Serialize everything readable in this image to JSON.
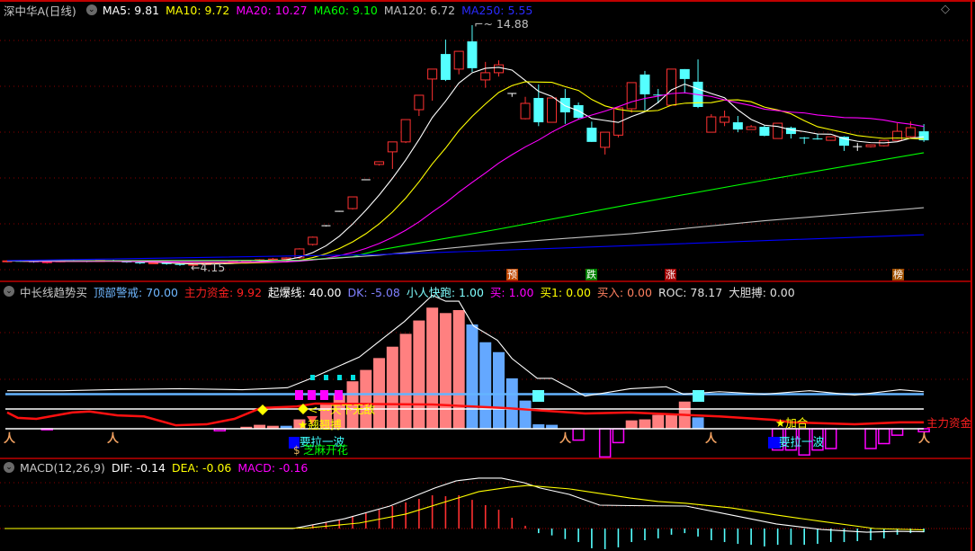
{
  "header": {
    "title": "深中华A(日线)",
    "ma5": "MA5: 9.81",
    "ma10": "MA10: 9.72",
    "ma20": "MA20: 10.27",
    "ma60": "MA60: 9.10",
    "ma120": "MA120: 6.72",
    "ma250": "MA250: 5.55"
  },
  "main_chart": {
    "high_label": "14.88",
    "low_label": "4.15",
    "badges": [
      "预",
      "跌",
      "涨",
      "榜"
    ],
    "candles": [
      [
        4.4,
        4.45,
        4.35,
        4.42
      ],
      [
        4.42,
        4.46,
        4.38,
        4.4
      ],
      [
        4.4,
        4.44,
        4.34,
        4.36
      ],
      [
        4.36,
        4.4,
        4.3,
        4.38
      ],
      [
        4.38,
        4.45,
        4.36,
        4.43
      ],
      [
        4.43,
        4.48,
        4.4,
        4.41
      ],
      [
        4.41,
        4.44,
        4.36,
        4.39
      ],
      [
        4.39,
        4.45,
        4.37,
        4.44
      ],
      [
        4.44,
        4.47,
        4.38,
        4.4
      ],
      [
        4.4,
        4.42,
        4.33,
        4.35
      ],
      [
        4.35,
        4.38,
        4.28,
        4.31
      ],
      [
        4.31,
        4.36,
        4.27,
        4.33
      ],
      [
        4.33,
        4.35,
        4.25,
        4.28
      ],
      [
        4.28,
        4.31,
        4.2,
        4.24
      ],
      [
        4.24,
        4.3,
        4.15,
        4.27
      ],
      [
        4.27,
        4.33,
        4.24,
        4.3
      ],
      [
        4.3,
        4.36,
        4.28,
        4.34
      ],
      [
        4.34,
        4.4,
        4.32,
        4.38
      ],
      [
        4.38,
        4.45,
        4.36,
        4.43
      ],
      [
        4.43,
        4.5,
        4.4,
        4.47
      ],
      [
        4.47,
        4.55,
        4.44,
        4.5
      ],
      [
        4.5,
        4.58,
        4.47,
        4.55
      ],
      [
        4.55,
        4.98,
        4.5,
        4.95
      ],
      [
        5.15,
        5.5,
        5.1,
        5.47
      ],
      [
        5.98,
        6.0,
        5.95,
        5.98
      ],
      [
        6.62,
        6.64,
        6.6,
        6.62
      ],
      [
        6.74,
        7.26,
        6.7,
        7.26
      ],
      [
        8.02,
        8.04,
        8.0,
        8.02
      ],
      [
        8.7,
        8.82,
        8.65,
        8.82
      ],
      [
        9.26,
        9.7,
        8.5,
        9.7
      ],
      [
        9.7,
        10.69,
        9.65,
        10.69
      ],
      [
        11.13,
        11.77,
        10.85,
        11.77
      ],
      [
        12.49,
        12.93,
        11.53,
        12.93
      ],
      [
        13.6,
        14.24,
        12.4,
        12.45
      ],
      [
        12.93,
        13.72,
        12.7,
        13.72
      ],
      [
        14.16,
        14.88,
        12.8,
        12.97
      ],
      [
        12.45,
        13.25,
        12.1,
        12.77
      ],
      [
        12.77,
        13.32,
        12.6,
        13.12
      ],
      [
        11.85,
        11.85,
        11.7,
        11.85
      ],
      [
        10.73,
        11.7,
        10.7,
        11.41
      ],
      [
        11.65,
        12.25,
        10.4,
        10.57
      ],
      [
        10.57,
        11.65,
        10.57,
        11.65
      ],
      [
        11.65,
        12.05,
        10.5,
        11.01
      ],
      [
        11.33,
        11.45,
        10.7,
        10.77
      ],
      [
        10.33,
        10.6,
        9.7,
        9.7
      ],
      [
        9.46,
        10.13,
        9.14,
        10.13
      ],
      [
        10.0,
        11.21,
        9.9,
        11.21
      ],
      [
        11.17,
        12.33,
        11.0,
        12.33
      ],
      [
        12.69,
        12.85,
        11.09,
        11.81
      ],
      [
        11.8,
        12.05,
        11.41,
        11.77
      ],
      [
        11.33,
        12.93,
        11.3,
        12.93
      ],
      [
        12.93,
        12.93,
        11.85,
        12.49
      ],
      [
        12.37,
        13.36,
        11.2,
        11.25
      ],
      [
        10.13,
        10.93,
        10.13,
        10.81
      ],
      [
        10.57,
        11.09,
        10.4,
        10.81
      ],
      [
        10.57,
        10.85,
        10.13,
        10.25
      ],
      [
        10.25,
        10.45,
        10.25,
        10.37
      ],
      [
        10.37,
        10.45,
        9.95,
        9.97
      ],
      [
        9.85,
        10.53,
        9.85,
        10.53
      ],
      [
        10.33,
        10.38,
        9.85,
        10.05
      ],
      [
        9.89,
        9.92,
        9.61,
        9.87
      ],
      [
        9.85,
        10.05,
        9.8,
        9.83
      ],
      [
        9.77,
        9.93,
        9.75,
        9.93
      ],
      [
        9.93,
        9.95,
        9.3,
        9.53
      ],
      [
        9.49,
        9.65,
        9.3,
        9.49
      ],
      [
        9.49,
        9.57,
        9.45,
        9.57
      ],
      [
        9.53,
        9.77,
        9.5,
        9.77
      ],
      [
        9.77,
        10.53,
        9.75,
        10.17
      ],
      [
        9.93,
        10.61,
        9.9,
        10.33
      ],
      [
        10.17,
        10.49,
        9.7,
        9.77
      ]
    ],
    "ma60": [
      [
        0,
        4.42
      ],
      [
        22,
        4.45
      ],
      [
        26,
        4.6
      ],
      [
        28,
        4.9
      ],
      [
        37,
        5.83
      ],
      [
        47,
        6.94
      ],
      [
        57,
        8.0
      ],
      [
        69,
        9.22
      ]
    ],
    "ma120": [
      [
        0,
        4.42
      ],
      [
        22,
        4.43
      ],
      [
        28,
        4.67
      ],
      [
        37,
        5.2
      ],
      [
        47,
        5.63
      ],
      [
        57,
        6.2
      ],
      [
        69,
        6.78
      ]
    ],
    "ma250": [
      [
        0,
        4.43
      ],
      [
        28,
        4.7
      ],
      [
        47,
        5.1
      ],
      [
        69,
        5.58
      ]
    ],
    "colors": {
      "ma5": "#ffffff",
      "ma10": "#ffff00",
      "ma20": "#ff00ff",
      "ma60": "#00ff00",
      "ma120": "#c0c0c0",
      "ma250": "#0000ff",
      "up": "#ff3232",
      "down": "#54ffff"
    }
  },
  "indicator": {
    "name": "中长线趋势买",
    "values": [
      {
        "label": "顶部警戒: 70.00",
        "color": "#6fb7ff"
      },
      {
        "label": "主力资金: 9.92",
        "color": "#ff2020"
      },
      {
        "label": "起爆线: 40.00",
        "color": "#ffffff"
      },
      {
        "label": "DK: -5.08",
        "color": "#8080ff"
      },
      {
        "label": "小人快跑: 1.00",
        "color": "#80ffff"
      },
      {
        "label": "买: 1.00",
        "color": "#ff00ff"
      },
      {
        "label": "买1: 0.00",
        "color": "#ffff00"
      },
      {
        "label": "买入: 0.00",
        "color": "#ff8060"
      },
      {
        "label": "ROC: 78.17",
        "color": "#e0e0e0"
      },
      {
        "label": "大胆搏: 0.00",
        "color": "#e0e0e0"
      }
    ],
    "top_warning_level": 70,
    "ignite_level": 40,
    "bars_up": [
      [
        18,
        4
      ],
      [
        19,
        8
      ],
      [
        20,
        6
      ],
      [
        22,
        19
      ],
      [
        24,
        51
      ],
      [
        25,
        70
      ],
      [
        26,
        96
      ],
      [
        27,
        119
      ],
      [
        28,
        143
      ],
      [
        29,
        166
      ],
      [
        30,
        192
      ],
      [
        31,
        219
      ],
      [
        32,
        245
      ],
      [
        33,
        234
      ],
      [
        34,
        240
      ],
      [
        47,
        17
      ],
      [
        48,
        19
      ],
      [
        49,
        28
      ],
      [
        50,
        30
      ],
      [
        51,
        55
      ]
    ],
    "bars_down": [
      [
        21,
        6
      ],
      [
        35,
        211
      ],
      [
        36,
        175
      ],
      [
        37,
        155
      ],
      [
        38,
        102
      ],
      [
        39,
        57
      ],
      [
        40,
        9
      ],
      [
        41,
        8
      ],
      [
        52,
        23
      ]
    ],
    "bars_neg": [
      [
        3,
        -2
      ],
      [
        16,
        -4
      ],
      [
        43,
        -23
      ],
      [
        45,
        -57
      ],
      [
        46,
        -28
      ],
      [
        58,
        -43
      ],
      [
        59,
        -43
      ],
      [
        60,
        -53
      ],
      [
        61,
        -43
      ],
      [
        62,
        -40
      ],
      [
        65,
        -40
      ],
      [
        66,
        -30
      ],
      [
        67,
        -13
      ],
      [
        69,
        -6
      ]
    ],
    "roc_line": [
      [
        0,
        77
      ],
      [
        4.2,
        77
      ],
      [
        7.6,
        79
      ],
      [
        13,
        81
      ],
      [
        17.7,
        79
      ],
      [
        21.1,
        83
      ],
      [
        22.7,
        100
      ],
      [
        26.5,
        145
      ],
      [
        29.9,
        217
      ],
      [
        32,
        270
      ],
      [
        33,
        258
      ],
      [
        34,
        258
      ],
      [
        35.1,
        208
      ],
      [
        36.9,
        179
      ],
      [
        38,
        142
      ],
      [
        39.9,
        102
      ],
      [
        41,
        102
      ],
      [
        43.5,
        66
      ],
      [
        46.9,
        81
      ],
      [
        49.6,
        85
      ],
      [
        50.9,
        70
      ],
      [
        53.6,
        75
      ],
      [
        57,
        70
      ],
      [
        60.4,
        77
      ],
      [
        63.8,
        68
      ],
      [
        67.2,
        79
      ],
      [
        69,
        75
      ]
    ],
    "main_fund_line": [
      [
        0,
        33
      ],
      [
        0.8,
        22
      ],
      [
        2.2,
        20
      ],
      [
        4.9,
        33
      ],
      [
        6.2,
        35
      ],
      [
        8.3,
        27
      ],
      [
        10.3,
        25
      ],
      [
        12.7,
        7
      ],
      [
        15,
        9
      ],
      [
        17.1,
        20
      ],
      [
        19.1,
        42
      ],
      [
        21.8,
        45
      ],
      [
        23.2,
        51
      ],
      [
        32,
        49
      ],
      [
        37.4,
        42
      ],
      [
        43.5,
        31
      ],
      [
        46.9,
        33
      ],
      [
        53.6,
        25
      ],
      [
        57.7,
        18
      ],
      [
        59,
        13
      ],
      [
        63.8,
        9
      ],
      [
        67.2,
        13
      ],
      [
        69,
        13
      ]
    ],
    "signals": {
      "invincible": "<---天下无敌",
      "bold_bet": "★翘翘搏",
      "pull_wave_1": "要拉一波",
      "sesame": "芝麻开花",
      "add_position": "★加合",
      "pull_wave_2": "要拉一波",
      "main_fund_label": "主力资金",
      "runner": "人"
    }
  },
  "macd": {
    "label": "MACD(12,26,9)",
    "dif": "DIF: -0.14",
    "dea": "DEA: -0.06",
    "macd": "MACD: -0.16",
    "bars": [
      [
        23,
        0.16
      ],
      [
        24,
        0.27
      ],
      [
        25,
        0.39
      ],
      [
        26,
        0.55
      ],
      [
        27,
        0.67
      ],
      [
        28,
        0.82
      ],
      [
        29,
        0.98
      ],
      [
        30,
        1.14
      ],
      [
        31,
        1.29
      ],
      [
        32,
        1.45
      ],
      [
        33,
        1.41
      ],
      [
        34,
        1.45
      ],
      [
        35,
        1.25
      ],
      [
        36,
        1.02
      ],
      [
        37,
        0.82
      ],
      [
        38,
        0.47
      ],
      [
        39,
        0.12
      ],
      [
        40,
        -0.2
      ],
      [
        41,
        -0.3
      ],
      [
        42,
        -0.46
      ],
      [
        43,
        -0.59
      ],
      [
        44,
        -0.86
      ],
      [
        45,
        -0.9
      ],
      [
        46,
        -0.82
      ],
      [
        47,
        -0.59
      ],
      [
        48,
        -0.51
      ],
      [
        49,
        -0.43
      ],
      [
        50,
        -0.27
      ],
      [
        51,
        -0.2
      ],
      [
        52,
        -0.35
      ],
      [
        53,
        -0.51
      ],
      [
        54,
        -0.59
      ],
      [
        55,
        -0.67
      ],
      [
        56,
        -0.71
      ],
      [
        57,
        -0.78
      ],
      [
        58,
        -0.71
      ],
      [
        59,
        -0.71
      ],
      [
        60,
        -0.71
      ],
      [
        61,
        -0.67
      ],
      [
        62,
        -0.59
      ],
      [
        63,
        -0.59
      ],
      [
        64,
        -0.55
      ],
      [
        65,
        -0.51
      ],
      [
        66,
        -0.43
      ],
      [
        67,
        -0.27
      ],
      [
        68,
        -0.2
      ],
      [
        69,
        -0.16
      ]
    ],
    "dif_line": [
      [
        -0.2,
        0
      ],
      [
        21.5,
        0
      ],
      [
        22,
        0.05
      ],
      [
        25.4,
        0.43
      ],
      [
        28.8,
        0.98
      ],
      [
        32.2,
        1.77
      ],
      [
        33.8,
        2.08
      ],
      [
        35.5,
        2.2
      ],
      [
        37.2,
        2.2
      ],
      [
        38.9,
        2.0
      ],
      [
        40.1,
        1.77
      ],
      [
        42.3,
        1.49
      ],
      [
        44.6,
        1.02
      ],
      [
        46.9,
        1.0
      ],
      [
        51.1,
        0.98
      ],
      [
        54.5,
        0.59
      ],
      [
        57.9,
        0.2
      ],
      [
        61.3,
        -0.04
      ],
      [
        64.7,
        -0.16
      ],
      [
        67,
        -0.12
      ],
      [
        69,
        -0.14
      ]
    ],
    "dea_line": [
      [
        -0.2,
        0
      ],
      [
        22.5,
        0.02
      ],
      [
        26.5,
        0.24
      ],
      [
        30,
        0.63
      ],
      [
        33.3,
        1.22
      ],
      [
        35.5,
        1.61
      ],
      [
        37.8,
        1.8
      ],
      [
        39.2,
        1.88
      ],
      [
        42.3,
        1.73
      ],
      [
        46.9,
        1.33
      ],
      [
        49,
        1.18
      ],
      [
        51.1,
        1.1
      ],
      [
        54.5,
        0.9
      ],
      [
        57.9,
        0.59
      ],
      [
        61.3,
        0.31
      ],
      [
        65.3,
        0.0
      ],
      [
        69,
        -0.06
      ]
    ]
  }
}
